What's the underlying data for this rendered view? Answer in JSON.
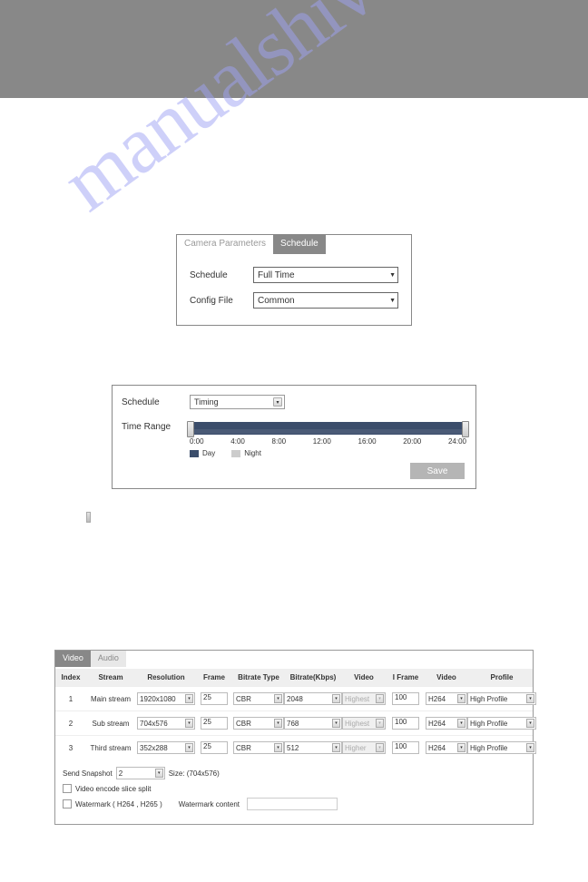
{
  "watermark": "manualshive.com",
  "panel1": {
    "tabs": [
      "Camera Parameters",
      "Schedule"
    ],
    "active_tab": "Schedule",
    "rows": [
      {
        "label": "Schedule",
        "value": "Full Time"
      },
      {
        "label": "Config File",
        "value": "Common"
      }
    ]
  },
  "panel2": {
    "schedule_label": "Schedule",
    "schedule_value": "Timing",
    "time_range_label": "Time Range",
    "ticks": [
      "0:00",
      "4:00",
      "8:00",
      "12:00",
      "16:00",
      "20:00",
      "24:00"
    ],
    "legend": {
      "day": "Day",
      "night": "Night"
    },
    "save": "Save"
  },
  "panel3": {
    "tabs": [
      "Video",
      "Audio"
    ],
    "active_tab": "Video",
    "headers": [
      "Index",
      "Stream",
      "Resolution",
      "Frame",
      "Bitrate Type",
      "Bitrate(Kbps)",
      "Video",
      "I Frame",
      "Video",
      "Profile"
    ],
    "rows": [
      {
        "index": "1",
        "stream": "Main stream",
        "resolution": "1920x1080",
        "frame": "25",
        "btype": "CBR",
        "bitrate": "2048",
        "video1": "Highest",
        "iframe": "100",
        "video2": "H264",
        "profile": "High Profile"
      },
      {
        "index": "2",
        "stream": "Sub stream",
        "resolution": "704x576",
        "frame": "25",
        "btype": "CBR",
        "bitrate": "768",
        "video1": "Highest",
        "iframe": "100",
        "video2": "H264",
        "profile": "High Profile"
      },
      {
        "index": "3",
        "stream": "Third stream",
        "resolution": "352x288",
        "frame": "25",
        "btype": "CBR",
        "bitrate": "512",
        "video1": "Higher",
        "iframe": "100",
        "video2": "H264",
        "profile": "High Profile"
      }
    ],
    "send_snapshot_label": "Send Snapshot",
    "send_snapshot_value": "2",
    "size_label": "Size: (704x576)",
    "slice_label": "Video encode slice split",
    "watermark_label": "Watermark ( H264 , H265 )",
    "watermark_content_label": "Watermark content"
  }
}
